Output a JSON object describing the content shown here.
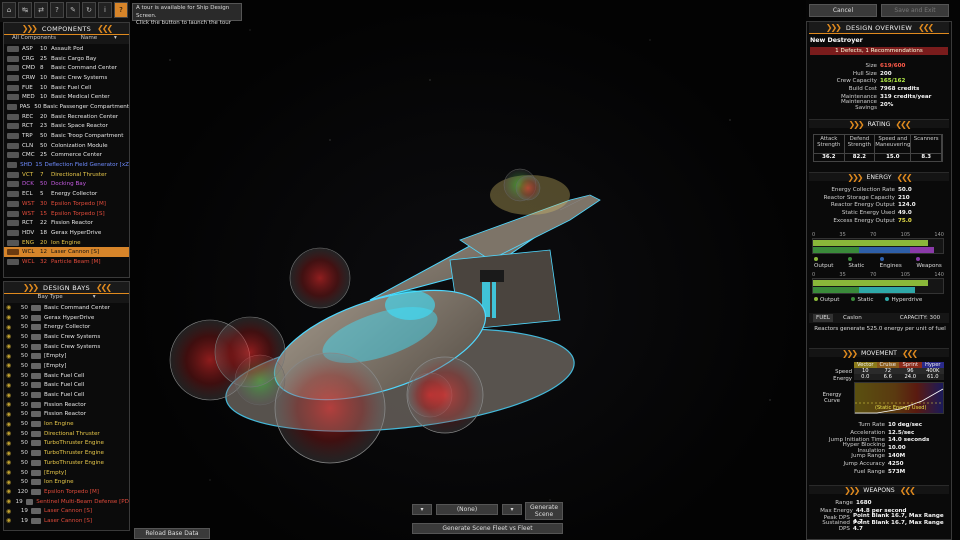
{
  "toolbar": {
    "tour_text_1": "A tour is available for Ship Design Screen.",
    "tour_text_2": "Click the button to launch the tour",
    "icons": [
      "ship-icon",
      "arrows-icon",
      "arrows-alt-icon",
      "help-icon",
      "tools-icon",
      "refresh-icon",
      "info-icon",
      "question-icon"
    ]
  },
  "components": {
    "title": "COMPONENTS",
    "filter": "All Components",
    "name_header": "Name",
    "items": [
      {
        "code": "ASP",
        "size": "10",
        "name": "Assault Pod",
        "color": "#e6e6e6"
      },
      {
        "code": "CRG",
        "size": "25",
        "name": "Basic Cargo Bay",
        "color": "#e6e6e6"
      },
      {
        "code": "CMD",
        "size": "8",
        "name": "Basic Command Center",
        "color": "#e6e6e6"
      },
      {
        "code": "CRW",
        "size": "10",
        "name": "Basic Crew Systems",
        "color": "#e6e6e6"
      },
      {
        "code": "FUE",
        "size": "10",
        "name": "Basic Fuel Cell",
        "color": "#e6e6e6"
      },
      {
        "code": "MED",
        "size": "10",
        "name": "Basic Medical Center",
        "color": "#e6e6e6"
      },
      {
        "code": "PAS",
        "size": "50",
        "name": "Basic Passenger Compartment",
        "color": "#e6e6e6"
      },
      {
        "code": "REC",
        "size": "20",
        "name": "Basic Recreation Center",
        "color": "#e6e6e6"
      },
      {
        "code": "RCT",
        "size": "23",
        "name": "Basic Space Reactor",
        "color": "#e6e6e6"
      },
      {
        "code": "TRP",
        "size": "50",
        "name": "Basic Troop Compartment",
        "color": "#e6e6e6"
      },
      {
        "code": "CLN",
        "size": "50",
        "name": "Colonization Module",
        "color": "#e6e6e6"
      },
      {
        "code": "CMC",
        "size": "25",
        "name": "Commerce Center",
        "color": "#e6e6e6"
      },
      {
        "code": "SHD",
        "size": "15",
        "name": "Deflection Field Generator [xZ",
        "color": "#6f8cff"
      },
      {
        "code": "VCT",
        "size": "7",
        "name": "Directional Thruster",
        "color": "#e8c84a"
      },
      {
        "code": "DCK",
        "size": "50",
        "name": "Docking Bay",
        "color": "#c35adf"
      },
      {
        "code": "ECL",
        "size": "5",
        "name": "Energy Collector",
        "color": "#e6e6e6"
      },
      {
        "code": "WST",
        "size": "30",
        "name": "Epsilon Torpedo [M]",
        "color": "#e24b3b"
      },
      {
        "code": "WST",
        "size": "15",
        "name": "Epsilon Torpedo [S]",
        "color": "#e24b3b"
      },
      {
        "code": "RCT",
        "size": "22",
        "name": "Fission Reactor",
        "color": "#e6e6e6"
      },
      {
        "code": "HDV",
        "size": "18",
        "name": "Gerax HyperDrive",
        "color": "#e6e6e6"
      },
      {
        "code": "ENG",
        "size": "20",
        "name": "Ion Engine",
        "color": "#e8c84a"
      },
      {
        "code": "WCL",
        "size": "12",
        "name": "Laser Cannon [S]",
        "color": "#e24b3b",
        "selected": true
      },
      {
        "code": "WCL",
        "size": "32",
        "name": "Particle Beam [M]",
        "color": "#e24b3b"
      }
    ]
  },
  "design_bays": {
    "title": "DESIGN BAYS",
    "filter": "Bay Type",
    "items": [
      {
        "size": "50",
        "name": "Basic Command Center",
        "color": "#e6e6e6"
      },
      {
        "size": "50",
        "name": "Gerax HyperDrive",
        "color": "#e6e6e6"
      },
      {
        "size": "50",
        "name": "Energy Collector",
        "color": "#e6e6e6"
      },
      {
        "size": "50",
        "name": "Basic Crew Systems",
        "color": "#e6e6e6"
      },
      {
        "size": "50",
        "name": "Basic Crew Systems",
        "color": "#e6e6e6"
      },
      {
        "size": "50",
        "name": "[Empty]",
        "color": "#e6e6e6"
      },
      {
        "size": "50",
        "name": "[Empty]",
        "color": "#e6e6e6"
      },
      {
        "size": "50",
        "name": "Basic Fuel Cell",
        "color": "#e6e6e6"
      },
      {
        "size": "50",
        "name": "Basic Fuel Cell",
        "color": "#e6e6e6"
      },
      {
        "size": "50",
        "name": "Basic Fuel Cell",
        "color": "#e6e6e6"
      },
      {
        "size": "50",
        "name": "Fission Reactor",
        "color": "#e6e6e6"
      },
      {
        "size": "50",
        "name": "Fission Reactor",
        "color": "#e6e6e6"
      },
      {
        "size": "50",
        "name": "Ion Engine",
        "color": "#e8c84a"
      },
      {
        "size": "50",
        "name": "Directional Thruster",
        "color": "#e8c84a"
      },
      {
        "size": "50",
        "name": "TurboThruster Engine",
        "color": "#e8c84a"
      },
      {
        "size": "50",
        "name": "TurboThruster Engine",
        "color": "#e8c84a"
      },
      {
        "size": "50",
        "name": "TurboThruster Engine",
        "color": "#e8c84a"
      },
      {
        "size": "50",
        "name": "[Empty]",
        "color": "#e8c84a"
      },
      {
        "size": "50",
        "name": "Ion Engine",
        "color": "#e8c84a"
      },
      {
        "size": "120",
        "name": "Epsilon Torpedo [M]",
        "color": "#e24b3b"
      },
      {
        "size": "19",
        "name": "Sentinel Multi-Beam Defense [PD",
        "color": "#e24b3b"
      },
      {
        "size": "19",
        "name": "Laser Cannon [S]",
        "color": "#e24b3b"
      },
      {
        "size": "19",
        "name": "Laser Cannon [S]",
        "color": "#e24b3b"
      }
    ]
  },
  "bottom": {
    "reload": "Reload Base Data",
    "none_select": "(None)",
    "generate_scene": "Generate Scene",
    "generate_fleet": "Generate Scene Fleet vs Fleet"
  },
  "top_right": {
    "cancel": "Cancel",
    "save_exit": "Save and Exit"
  },
  "overview": {
    "title": "DESIGN OVERVIEW",
    "ship_name": "New Destroyer",
    "defects": "1 Defects, 1 Recommendations",
    "stats": [
      {
        "k": "Size",
        "v": "619/600",
        "color": "#ff5b4a"
      },
      {
        "k": "Hull Size",
        "v": "200",
        "color": "#f5f5f5"
      },
      {
        "k": "Crew Capacity",
        "v": "165/162",
        "color": "#b6f04a"
      },
      {
        "k": "Build Cost",
        "v": "7968 credits",
        "color": "#f5f5f5"
      },
      {
        "k": "Maintenance",
        "v": "319 credits/year",
        "color": "#f5f5f5"
      },
      {
        "k": "Maintenance Savings",
        "v": "20%",
        "color": "#f5f5f5"
      }
    ]
  },
  "rating": {
    "title": "RATING",
    "headers": [
      "Attack Strength",
      "Defend Strength",
      "Speed and Maneuvering",
      "Scanners"
    ],
    "values": [
      "36.2",
      "82.2",
      "15.0",
      "8.3"
    ]
  },
  "energy": {
    "title": "ENERGY",
    "stats": [
      {
        "k": "Energy Collection Rate",
        "v": "50.0",
        "color": "#f5f5f5"
      },
      {
        "k": "Reactor Storage Capacity",
        "v": "210",
        "color": "#f5f5f5"
      },
      {
        "k": "Reactor Energy Output",
        "v": "124.0",
        "color": "#f5f5f5"
      },
      {
        "k": "Static Energy Used",
        "v": "49.0",
        "color": "#f5f5f5"
      },
      {
        "k": "Excess Energy Output",
        "v": "75.0",
        "color": "#e8e04a"
      }
    ],
    "scale": [
      "0",
      "35",
      "70",
      "105",
      "140"
    ],
    "chart1_legend": [
      "Output",
      "Static",
      "Engines",
      "Weapons"
    ],
    "chart2_legend": [
      "Output",
      "Static",
      "Hyperdrive"
    ],
    "fuel_label": "FUEL",
    "fuel_type": "Caslon",
    "fuel_capacity": "CAPACITY: 300",
    "fuel_note": "Reactors generate 525.0 energy per unit of fuel"
  },
  "movement": {
    "title": "MOVEMENT",
    "headers": [
      "Vector",
      "Cruise",
      "Sprint",
      "Hyper"
    ],
    "speed_label": "Speed",
    "energy_label": "Energy",
    "speed": [
      "10",
      "72",
      "96",
      "400K"
    ],
    "energy_vals": [
      "0.0",
      "6.6",
      "24.0",
      "61.0"
    ],
    "curve_label": "Energy Curve",
    "static_label": "(Static Energy Used)",
    "stats": [
      {
        "k": "Turn Rate",
        "v": "10 deg/sec"
      },
      {
        "k": "Acceleration",
        "v": "12.5/sec"
      },
      {
        "k": "Jump Initiation Time",
        "v": "14.0 seconds"
      },
      {
        "k": "Hyper Blocking Insulation",
        "v": "10.00"
      },
      {
        "k": "Jump Range",
        "v": "140M"
      },
      {
        "k": "Jump Accuracy",
        "v": "4250"
      },
      {
        "k": "Fuel Range",
        "v": "573M"
      }
    ]
  },
  "weapons": {
    "title": "WEAPONS",
    "stats": [
      {
        "k": "Range",
        "v": "1680"
      },
      {
        "k": "Max Energy",
        "v": "44.8 per second"
      },
      {
        "k": "Peak DPS",
        "v": "Point Blank 16.7, Max Range 4.7"
      },
      {
        "k": "Sustained DPS",
        "v": "Point Blank 16.7, Max Range 4.7"
      }
    ]
  },
  "colors": {
    "accent": "#e08a1e",
    "selected": "#d7852a",
    "weapon": "#e24b3b",
    "engine": "#e8c84a",
    "shield": "#6f8cff"
  }
}
